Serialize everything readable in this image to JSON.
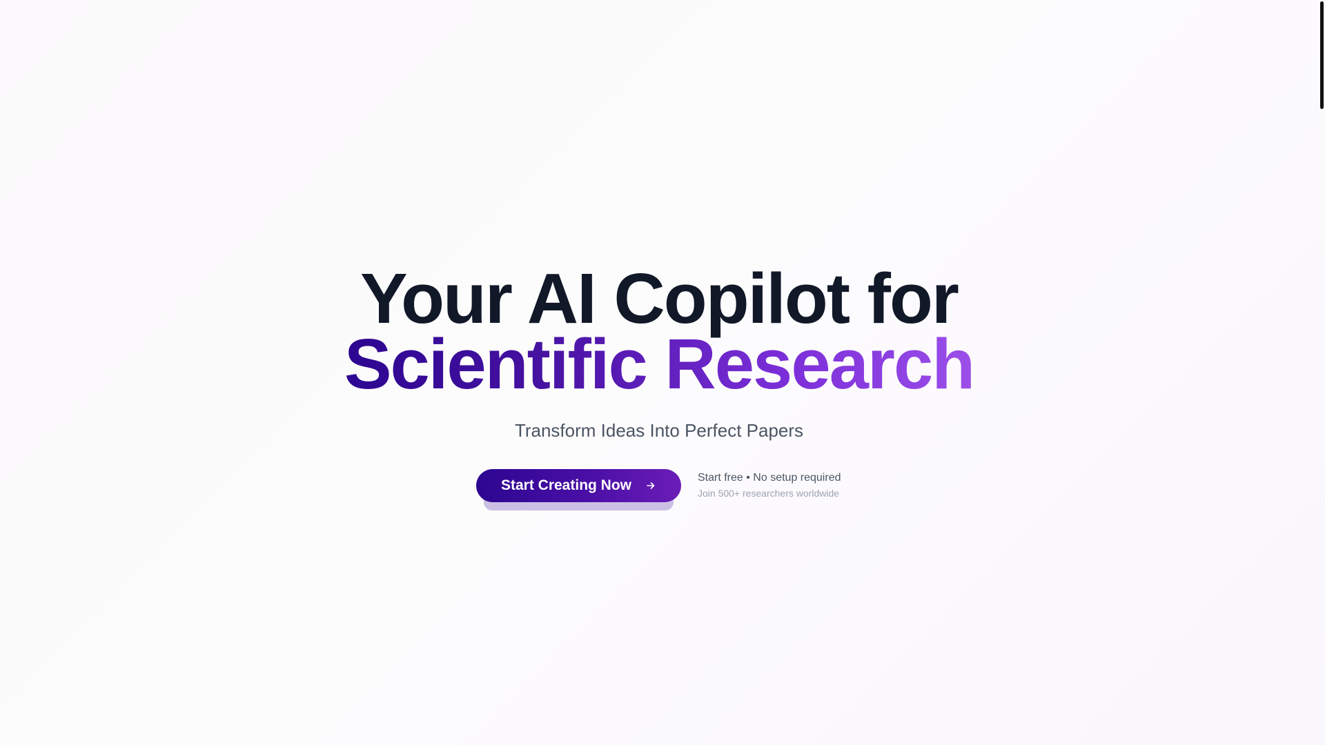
{
  "hero": {
    "headline_line1": "Your AI Copilot for",
    "headline_line2": "Scientific Research",
    "subtitle": "Transform Ideas Into Perfect Papers"
  },
  "cta": {
    "button_label": "Start Creating Now",
    "button_icon": "arrow-right-icon",
    "note_primary": "Start free • No setup required",
    "note_secondary": "Join 500+ researchers worldwide"
  },
  "colors": {
    "accent_start": "#2c0691",
    "accent_end": "#9c4fe9",
    "headline": "#111827",
    "body_text": "#4b5563",
    "muted_text": "#9ca3af",
    "background": "#fcfafc"
  }
}
